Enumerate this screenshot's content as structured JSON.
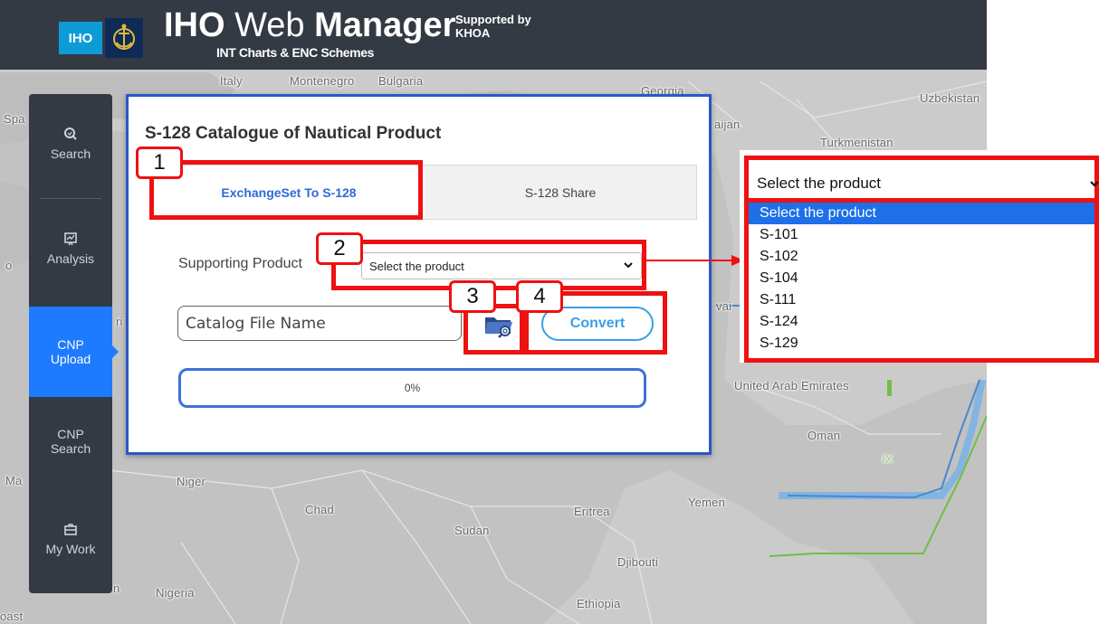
{
  "header": {
    "logo_text": "IHO",
    "title_bold": "IHO",
    "title_mid": " Web ",
    "title_bold2": "Manager",
    "subtitle": "INT Charts & ENC Schemes",
    "supported_line1": "Supported by",
    "supported_line2": "KHOA"
  },
  "map": {
    "labels": [
      "Italy",
      "Montenegro",
      "Bulgaria",
      "Georgia",
      "Uzbekistan",
      "Spa",
      "aijan",
      "Turkmenistan",
      "Niger",
      "Chad",
      "Sudan",
      "Eritrea",
      "Yemen",
      "Oman",
      "United Arab Emirates",
      "Djibouti",
      "Nigeria",
      "Ethiopia",
      "Ma",
      "oast",
      "ri",
      "vai",
      "IX",
      "o",
      "n"
    ]
  },
  "sidebar": {
    "items": [
      {
        "label": "Search",
        "icon": "search-icon"
      },
      {
        "label": "Analysis",
        "icon": "analysis-icon"
      },
      {
        "label": "CNP Upload",
        "icon": ""
      },
      {
        "label": "CNP Search",
        "icon": ""
      },
      {
        "label": "My Work",
        "icon": "briefcase-icon"
      }
    ],
    "active": "CNP Upload"
  },
  "dialog": {
    "title": "S-128 Catalogue of Nautical Product",
    "tabs": [
      {
        "label": "ExchangeSet To S-128",
        "active": true
      },
      {
        "label": "S-128 Share",
        "active": false
      }
    ],
    "supporting_label": "Supporting Product",
    "select_value": "Select the product",
    "file_placeholder": "Catalog File Name",
    "convert_label": "Convert",
    "progress_text": "0%",
    "progress_value": 0
  },
  "dropdown": {
    "selected": "Select the product",
    "options": [
      "Select the product",
      "S-101",
      "S-102",
      "S-104",
      "S-111",
      "S-124",
      "S-129"
    ]
  },
  "annotations": [
    "1",
    "2",
    "3",
    "4"
  ],
  "colors": {
    "accent": "#1e7bff",
    "annotation_red": "#ee1111",
    "header_bg": "#343a44",
    "dialog_border": "#2c58c6"
  }
}
